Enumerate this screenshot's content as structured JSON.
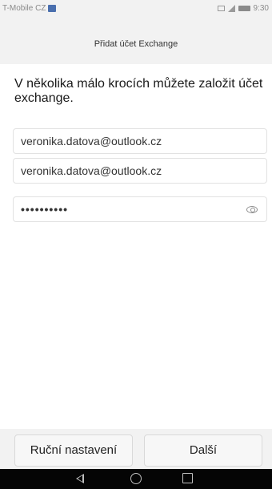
{
  "status_bar": {
    "carrier": "T-Mobile CZ",
    "time": "9:30"
  },
  "header": {
    "title": "Přidat účet Exchange"
  },
  "main": {
    "heading": "V několika málo krocích můžete založit účet exchange.",
    "email_field": {
      "value": "veronika.datova@outlook.cz"
    },
    "username_field": {
      "value": "veronika.datova@outlook.cz"
    },
    "password_field": {
      "value": "••••••••••"
    }
  },
  "footer": {
    "manual_label": "Ruční nastavení",
    "next_label": "Další"
  },
  "icons": {
    "notification": "notification-icon",
    "gallery": "image-icon",
    "signal": "signal-icon",
    "battery": "battery-icon",
    "password_toggle": "eye-icon",
    "nav_back": "back-icon",
    "nav_home": "home-icon",
    "nav_recent": "recent-apps-icon"
  },
  "colors": {
    "nav_bar": "#050505",
    "page_background": "#f2f2f2",
    "content_background": "#ffffff",
    "notification_accent": "#4a6fae"
  }
}
